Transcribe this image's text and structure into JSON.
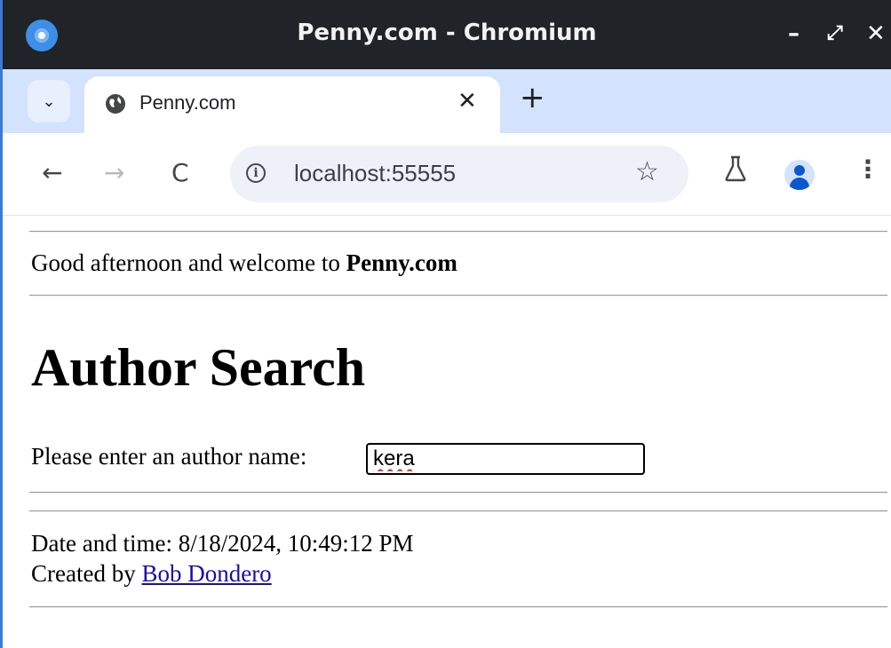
{
  "window": {
    "title": "Penny.com - Chromium",
    "minimize_label": "–",
    "maximize_label": "⤢",
    "close_label": "✕"
  },
  "tabs": {
    "menu_label": "⌄",
    "active_title": "Penny.com",
    "close_label": "✕",
    "new_tab_label": "+"
  },
  "toolbar": {
    "back_label": "←",
    "forward_label": "→",
    "reload_label": "C",
    "info_label": "i",
    "url": "localhost:55555",
    "bookmark_label": "☆",
    "menu_label": "⋮"
  },
  "page": {
    "greeting_prefix": "Good afternoon and welcome to ",
    "greeting_site": "Penny.com",
    "heading": "Author Search",
    "prompt_label": "Please enter an author name:",
    "author_input_value": "kera",
    "datetime_label": "Date and time: 8/18/2024, 10:49:12 PM",
    "created_by_prefix": "Created by ",
    "creator_name": "Bob Dondero"
  },
  "colors": {
    "titlebar": "#202328",
    "tabstrip": "#d3e3fd",
    "link": "#1a0dab",
    "accent": "#0b57d0"
  }
}
